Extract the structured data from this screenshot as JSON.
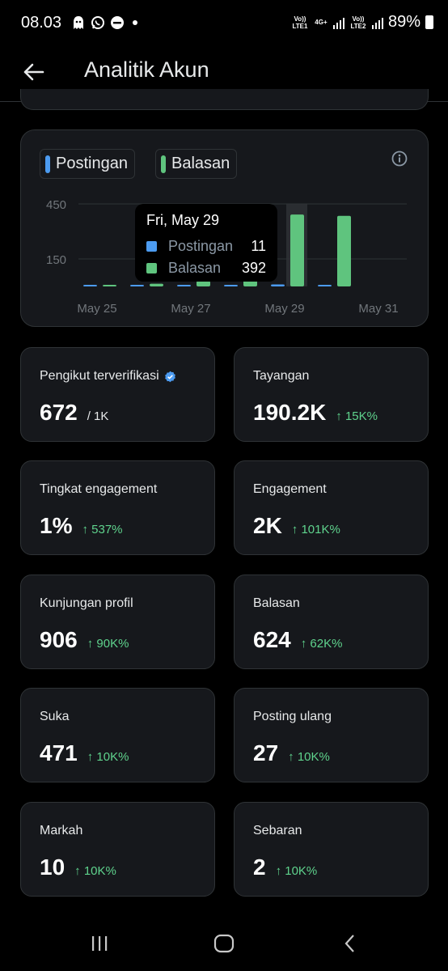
{
  "status_bar": {
    "time": "08.03",
    "sim1": "Vo)) LTE1",
    "sim2": "Vo)) LTE2",
    "net_type": "4G+",
    "battery": "89%"
  },
  "header": {
    "title": "Analitik Akun"
  },
  "chart": {
    "legend": [
      {
        "label": "Postingan",
        "color": "#4c9bf0"
      },
      {
        "label": "Balasan",
        "color": "#5fc47e"
      }
    ],
    "tooltip": {
      "title": "Fri, May 29",
      "rows": [
        {
          "name": "Postingan",
          "value": "11",
          "color": "#4c9bf0"
        },
        {
          "name": "Balasan",
          "value": "392",
          "color": "#5fc47e"
        }
      ]
    }
  },
  "chart_data": {
    "type": "bar",
    "categories": [
      "May 25",
      "May 26",
      "May 27",
      "May 28",
      "May 29",
      "May 30"
    ],
    "series": [
      {
        "name": "Postingan",
        "values": [
          1,
          1,
          3,
          8,
          11,
          6
        ]
      },
      {
        "name": "Balasan",
        "values": [
          1,
          15,
          30,
          60,
          392,
          385
        ]
      }
    ],
    "y_ticks": [
      "450",
      "150"
    ],
    "x_ticks": [
      "May 25",
      "May 27",
      "May 29",
      "May 31"
    ],
    "ylim": [
      0,
      450
    ],
    "highlight_category": "May 29"
  },
  "metrics": [
    {
      "label": "Pengikut terverifikasi",
      "value": "672",
      "sub": "/ 1K",
      "change": "",
      "verified": true
    },
    {
      "label": "Tayangan",
      "value": "190.2K",
      "change": "↑ 15K%"
    },
    {
      "label": "Tingkat engagement",
      "value": "1%",
      "change": "↑ 537%"
    },
    {
      "label": "Engagement",
      "value": "2K",
      "change": "↑ 101K%"
    },
    {
      "label": "Kunjungan profil",
      "value": "906",
      "change": "↑ 90K%"
    },
    {
      "label": "Balasan",
      "value": "624",
      "change": "↑ 62K%"
    },
    {
      "label": "Suka",
      "value": "471",
      "change": "↑ 10K%"
    },
    {
      "label": "Posting ulang",
      "value": "27",
      "change": "↑ 10K%"
    },
    {
      "label": "Markah",
      "value": "10",
      "change": "↑ 10K%"
    },
    {
      "label": "Sebaran",
      "value": "2",
      "change": "↑ 10K%"
    }
  ]
}
